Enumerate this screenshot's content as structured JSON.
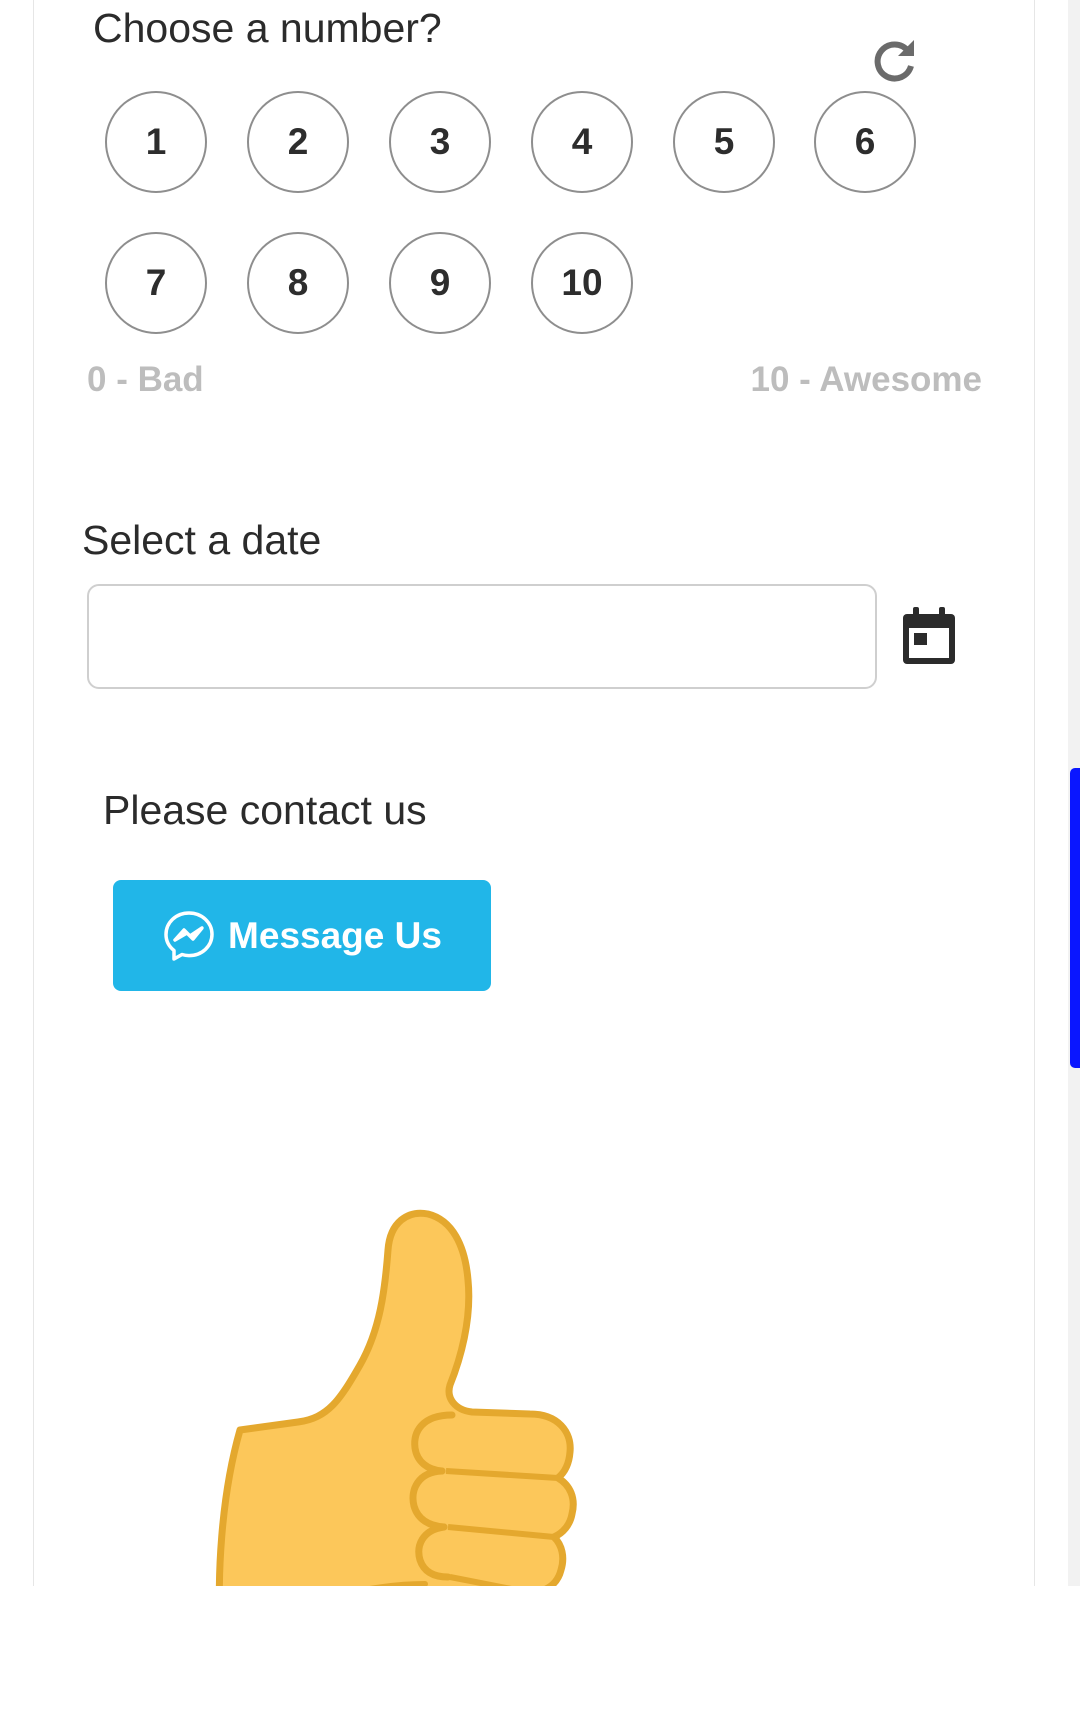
{
  "number_question": {
    "title": "Choose a number?",
    "options": [
      "1",
      "2",
      "3",
      "4",
      "5",
      "6",
      "7",
      "8",
      "9",
      "10"
    ],
    "low_label": "0 - Bad",
    "high_label": "10 - Awesome",
    "reset_icon": "reload-icon"
  },
  "date_question": {
    "title": "Select a date",
    "value": "",
    "placeholder": "",
    "calendar_icon": "calendar-icon"
  },
  "contact": {
    "title": "Please contact us",
    "button_label": "Message Us",
    "button_icon": "messenger-icon",
    "button_color": "#21b6e8"
  },
  "image": {
    "icon": "thumbs-up-icon"
  },
  "colors": {
    "scrollbar_thumb": "#0a16ff",
    "scale_label": "#bdbdbd"
  }
}
